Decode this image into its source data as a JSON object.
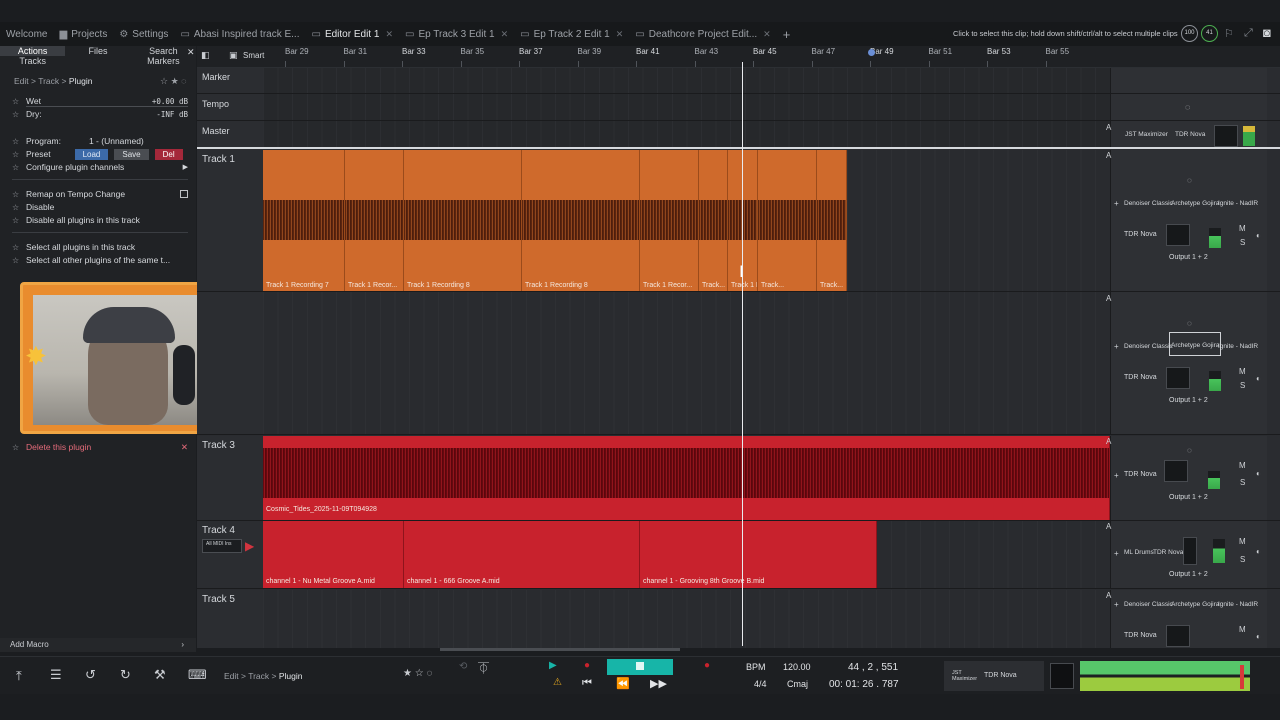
{
  "tabs": [
    {
      "label": "Welcome",
      "icon": "none"
    },
    {
      "label": "Projects",
      "icon": "folder-icon"
    },
    {
      "label": "Settings",
      "icon": "gear-icon"
    },
    {
      "label": "Abasi Inspired track E...",
      "icon": "document-icon"
    },
    {
      "label": "Editor Edit 1",
      "icon": "document-icon",
      "active": true
    },
    {
      "label": "Ep Track 3 Edit 1",
      "icon": "document-icon"
    },
    {
      "label": "Ep Track 2 Edit 1",
      "icon": "document-icon"
    },
    {
      "label": "Deathcore Project Edit...",
      "icon": "document-icon"
    }
  ],
  "hint": "Click to select this clip; hold down shift/ctrl/alt to select multiple clips",
  "badges": [
    "100",
    "41"
  ],
  "left_panel": {
    "tabs": [
      "Actions",
      "Files",
      "Search",
      "Tracks",
      "",
      "Markers"
    ],
    "breadcrumb": {
      "a": "Edit",
      "b": "Track",
      "c": "Plugin"
    },
    "wet_label": "Wet",
    "wet_value": "+0.00 dB",
    "dry_label": "Dry:",
    "dry_value": "-INF dB",
    "program_label": "Program:",
    "program_value": "1 - (Unnamed)",
    "preset_label": "Preset",
    "load": "Load",
    "save": "Save",
    "del": "Del",
    "configure": "Configure plugin channels",
    "remap": "Remap on Tempo Change",
    "disable": "Disable",
    "disable_all": "Disable all plugins in this track",
    "select_all": "Select all plugins in this track",
    "select_others": "Select all other plugins of the same t...",
    "delete": "Delete this plugin",
    "add_macro": "Add Macro"
  },
  "ruler": {
    "mode": "Smart",
    "bars": [
      {
        "label": "Bar 29",
        "major": false
      },
      {
        "label": "Bar 31",
        "major": false
      },
      {
        "label": "Bar 33",
        "major": true
      },
      {
        "label": "Bar 35",
        "major": false
      },
      {
        "label": "Bar 37",
        "major": true
      },
      {
        "label": "Bar 39",
        "major": false
      },
      {
        "label": "Bar 41",
        "major": true
      },
      {
        "label": "Bar 43",
        "major": false
      },
      {
        "label": "Bar 45",
        "major": true
      },
      {
        "label": "Bar 47",
        "major": false
      },
      {
        "label": "Bar 49",
        "major": true
      },
      {
        "label": "Bar 51",
        "major": false
      },
      {
        "label": "Bar 53",
        "major": true
      },
      {
        "label": "Bar 55",
        "major": false
      }
    ]
  },
  "rows": {
    "marker": "Marker",
    "tempo": "Tempo",
    "master": "Master"
  },
  "tracks": {
    "t1": "Track 1",
    "t3": "Track 3",
    "t4": "Track 4",
    "t5": "Track 5",
    "t4_input": "All MIDI Ins"
  },
  "clips_t1": [
    "Track 1 Recording 7",
    "Track 1 Recor...",
    "Track 1 Recording 8",
    "Track 1 Recording 8",
    "Track 1 Recor...",
    "Track...",
    "Track 1 Recor...",
    "Track...",
    "Track..."
  ],
  "clip_t3": "Cosmic_Tides_2025-11-09T094928",
  "clips_t4": [
    "channel 1 - Nu Metal Groove A.mid",
    "channel 1 - 666 Groove A.mid",
    "channel 1 - Grooving 8th Groove B.mid"
  ],
  "mixer": {
    "master_plugins": [
      "JST Maximizer",
      "TDR Nova"
    ],
    "t1_plugins": [
      "Denoiser Classic",
      "Archetype Gojira",
      "Ignite - NadIR"
    ],
    "tdr": "TDR Nova",
    "ml": "ML Drums",
    "output": "Output 1 + 2",
    "m": "M",
    "s": "S"
  },
  "transport": {
    "crumb_a": "Edit",
    "crumb_b": "Track",
    "crumb_c": "Plugin",
    "bpm_label": "BPM",
    "bpm": "120.00",
    "sig": "4/4",
    "key": "Cmaj",
    "position": "44 , 2 , 551",
    "time": "00: 01: 26 . 787",
    "plugin_a": "JST Maximizer",
    "plugin_b": "TDR Nova"
  }
}
